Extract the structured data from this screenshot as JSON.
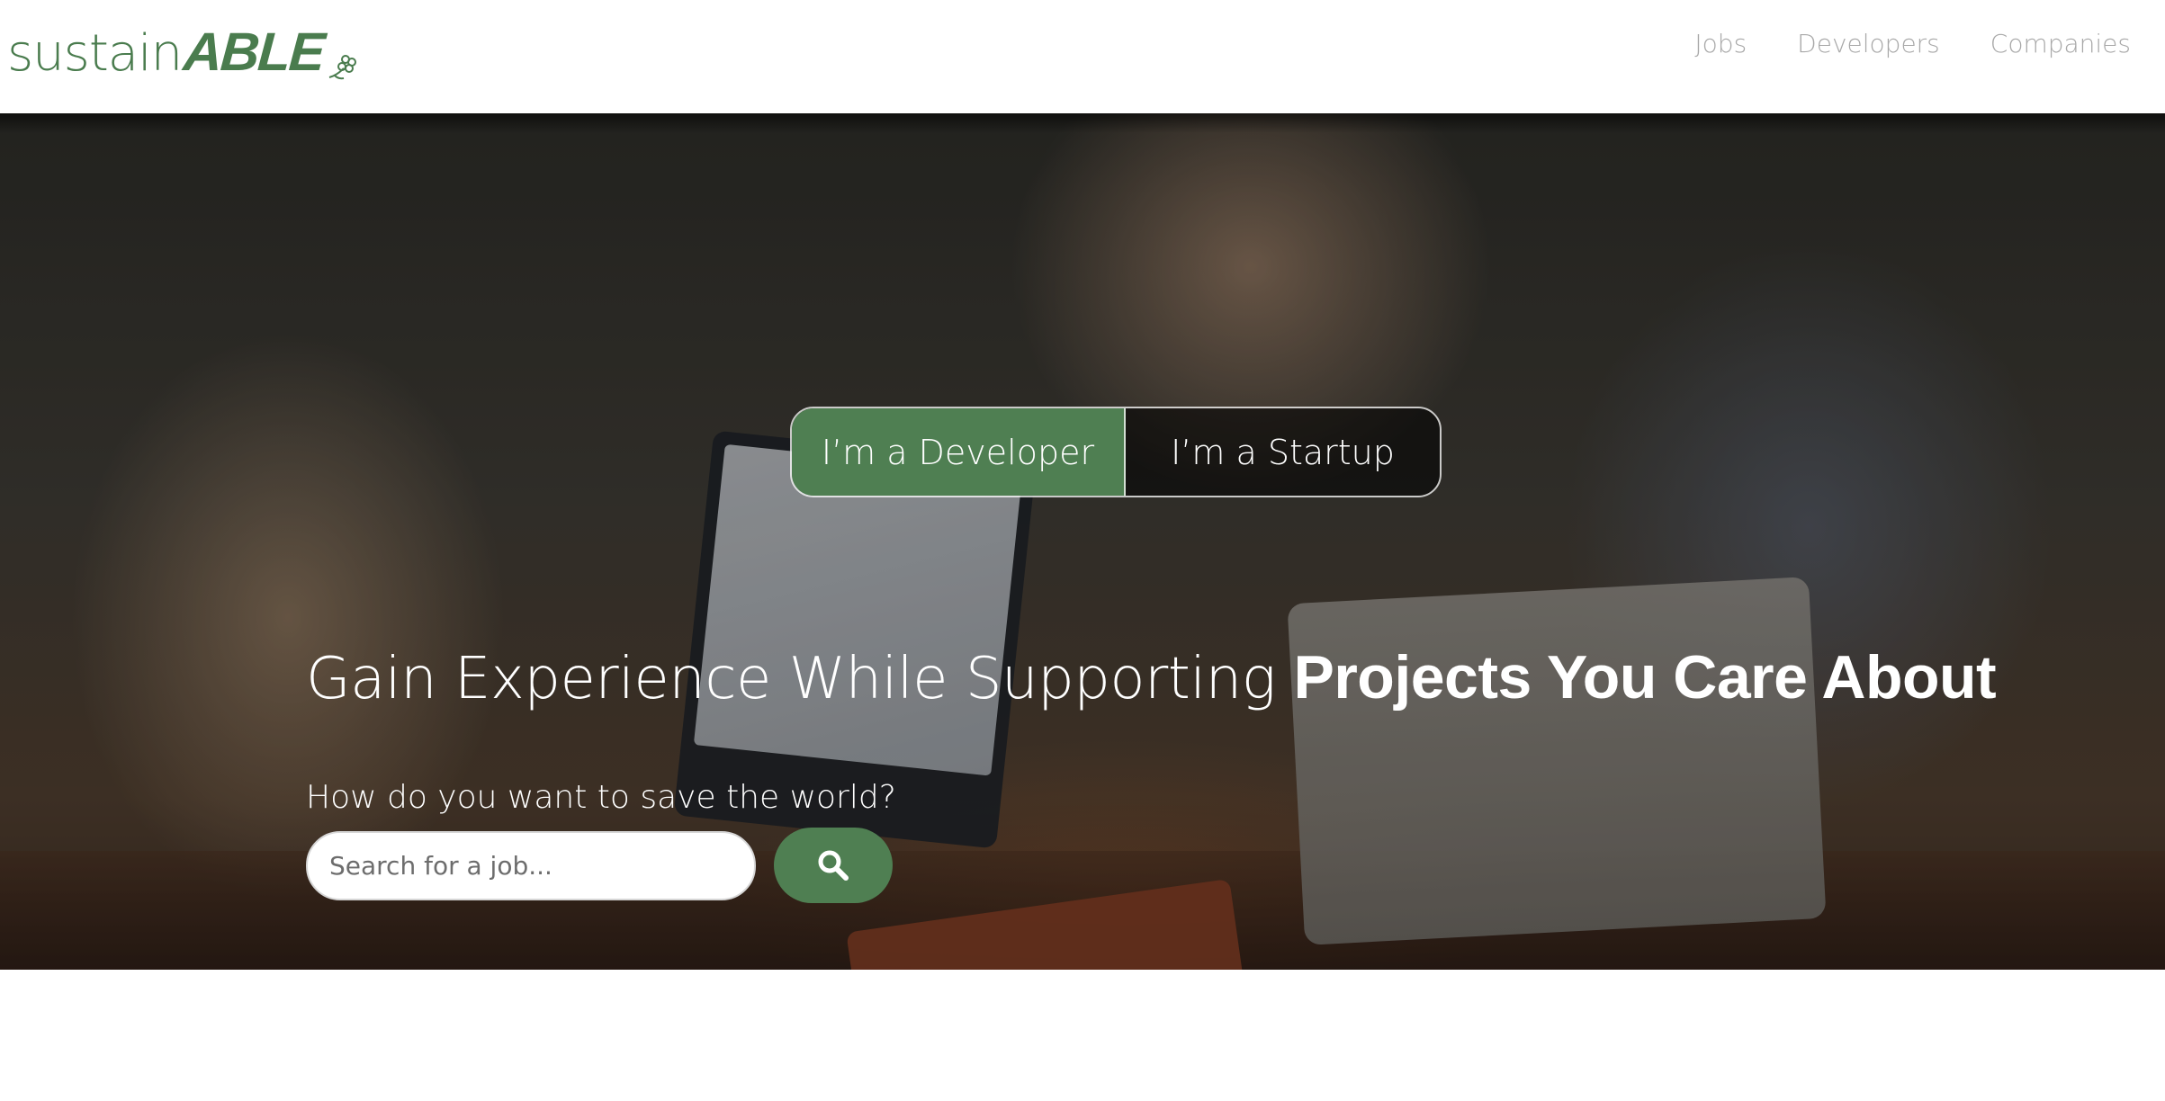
{
  "brand": {
    "logo_light": "sustain",
    "logo_bold": "ABLE",
    "color": "#4a7c4e"
  },
  "nav": {
    "items": [
      {
        "label": "Jobs"
      },
      {
        "label": "Developers"
      },
      {
        "label": "Companies"
      }
    ]
  },
  "hero": {
    "toggle": {
      "developer_label": "I’m a Developer",
      "startup_label": "I’m a Startup",
      "selected": "developer"
    },
    "headline_light": "Gain Experience While Supporting ",
    "headline_bold": "Projects You Care About",
    "question": "How do you want to save the world?",
    "search": {
      "placeholder": "Search for a job...",
      "value": "",
      "button_icon": "search-icon"
    }
  },
  "colors": {
    "accent": "#4f7f52",
    "nav_text": "#a8a8a8"
  }
}
